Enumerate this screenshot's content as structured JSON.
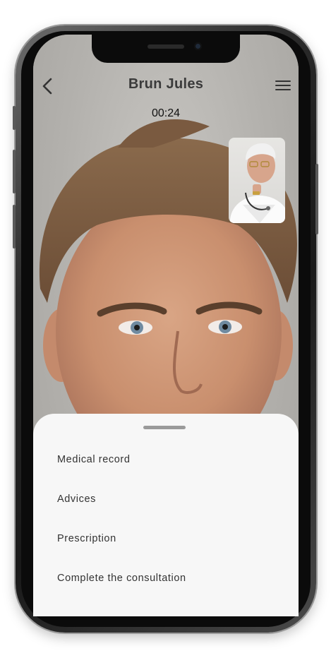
{
  "header": {
    "title": "Brun Jules",
    "back_icon": "chevron-left-icon",
    "menu_icon": "hamburger-menu-icon"
  },
  "call": {
    "timer": "00:24"
  },
  "sheet": {
    "items": [
      {
        "label": "Medical record"
      },
      {
        "label": "Advices"
      },
      {
        "label": "Prescription"
      },
      {
        "label": "Complete the consultation"
      }
    ]
  },
  "colors": {
    "sheet_bg": "#f7f7f7",
    "text_dark": "#333333",
    "title": "#3b3b3b"
  }
}
